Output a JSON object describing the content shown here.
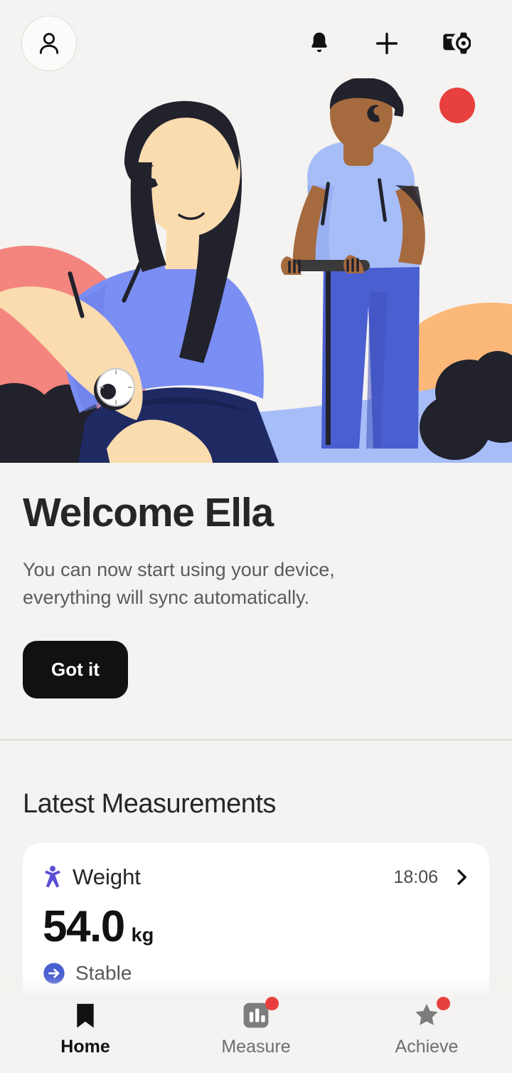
{
  "header": {
    "avatar_name": "profile-avatar",
    "actions": [
      {
        "name": "notifications-icon",
        "label": "Notifications"
      },
      {
        "name": "add-icon",
        "label": "Add"
      },
      {
        "name": "devices-icon",
        "label": "Devices"
      }
    ]
  },
  "illustration": {
    "alt": "Two people outdoors, one wearing a smartwatch",
    "colors": {
      "background": "#f4f3f1",
      "pink_blob": "#f4847e",
      "peach_blob": "#fbb878",
      "skin_light": "#fbdcaf",
      "skin_dark": "#a66a3f",
      "hair_dark": "#21222b",
      "shirt_blue": "#7b8ef4",
      "shirt_light_blue": "#a7bdf8",
      "pants_navy": "#1f2a63",
      "pants_blue": "#4a5fd0",
      "ground_blue": "#a7bdf8",
      "red_dot": "#e8403f"
    }
  },
  "welcome": {
    "title": "Welcome Ella",
    "subtitle": "You can now start using your device, everything will sync automatically.",
    "button_label": "Got it"
  },
  "latest": {
    "section_title": "Latest Measurements",
    "cards": [
      {
        "icon": "body-figure-icon",
        "label": "Weight",
        "time": "18:06",
        "value": "54.0",
        "unit": "kg",
        "trend_icon": "arrow-right-circle-icon",
        "trend_label": "Stable",
        "accent": "#5b4fd6",
        "trend_color": "#4a5fd0"
      }
    ]
  },
  "bottom_nav": {
    "items": [
      {
        "label": "Home",
        "icon": "bookmark-icon",
        "active": true,
        "badge": false
      },
      {
        "label": "Measure",
        "icon": "bar-chart-icon",
        "active": false,
        "badge": true
      },
      {
        "label": "Achieve",
        "icon": "star-icon",
        "active": false,
        "badge": true
      }
    ]
  }
}
